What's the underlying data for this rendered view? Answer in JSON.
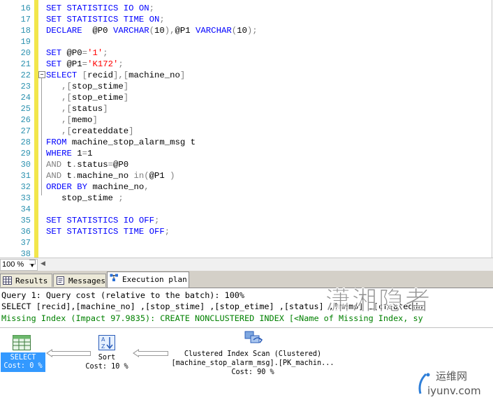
{
  "editor": {
    "lines": [
      {
        "n": "16",
        "t": "SET STATISTICS IO ON;"
      },
      {
        "n": "17",
        "t": "SET STATISTICS TIME ON;"
      },
      {
        "n": "18",
        "t": "DECLARE  @P0 VARCHAR(10),@P1 VARCHAR(10);"
      },
      {
        "n": "19",
        "t": ""
      },
      {
        "n": "20",
        "t": "SET @P0='1';"
      },
      {
        "n": "21",
        "t": "SET @P1='K172';"
      },
      {
        "n": "22",
        "t": "SELECT [recid],[machine_no]"
      },
      {
        "n": "23",
        "t": "   ,[stop_stime]"
      },
      {
        "n": "24",
        "t": "   ,[stop_etime]"
      },
      {
        "n": "25",
        "t": "   ,[status]"
      },
      {
        "n": "26",
        "t": "   ,[memo]"
      },
      {
        "n": "27",
        "t": "   ,[createddate]"
      },
      {
        "n": "28",
        "t": "FROM machine_stop_alarm_msg t"
      },
      {
        "n": "29",
        "t": "WHERE 1=1"
      },
      {
        "n": "30",
        "t": "AND t.status=@P0"
      },
      {
        "n": "31",
        "t": "AND t.machine_no in(@P1 )"
      },
      {
        "n": "32",
        "t": "ORDER BY machine_no,"
      },
      {
        "n": "33",
        "t": "   stop_stime ;"
      },
      {
        "n": "34",
        "t": ""
      },
      {
        "n": "35",
        "t": "SET STATISTICS IO OFF;"
      },
      {
        "n": "36",
        "t": "SET STATISTICS TIME OFF;"
      },
      {
        "n": "37",
        "t": ""
      },
      {
        "n": "38",
        "t": ""
      }
    ]
  },
  "statusbar": {
    "zoom": "100 %"
  },
  "tabs": [
    {
      "label": "Results",
      "icon": "grid-icon"
    },
    {
      "label": "Messages",
      "icon": "message-icon"
    },
    {
      "label": "Execution plan",
      "icon": "plan-icon",
      "active": true
    }
  ],
  "plan": {
    "header1": "Query 1: Query cost (relative to the batch): 100%",
    "header2": "SELECT [recid],[machine_no] ,[stop_stime] ,[stop_etime] ,[status] ,[memo] ,[createdda",
    "header3": "Missing Index (Impact 97.9835): CREATE NONCLUSTERED INDEX [<Name of Missing Index, sy",
    "nodes": [
      {
        "name": "SELECT",
        "cost": "Cost: 0 %",
        "icon": "select-icon",
        "selected": true
      },
      {
        "name": "Sort",
        "cost": "Cost: 10 %",
        "icon": "sort-icon"
      },
      {
        "name": "Clustered Index Scan (Clustered)",
        "sub": "[machine_stop_alarm_msg].[PK_machin...",
        "cost": "Cost: 90 %",
        "icon": "clustered-index-scan-icon"
      }
    ]
  },
  "watermark": {
    "text": "潇湘隐者",
    "site": "iyunv.com",
    "site_cn": "运维网"
  },
  "colors": {
    "keyword": "#0000ff",
    "string": "#ff0000",
    "operator": "#808080",
    "linenumber": "#2b91af",
    "missingindex": "#008000",
    "selected": "#3399ff"
  }
}
